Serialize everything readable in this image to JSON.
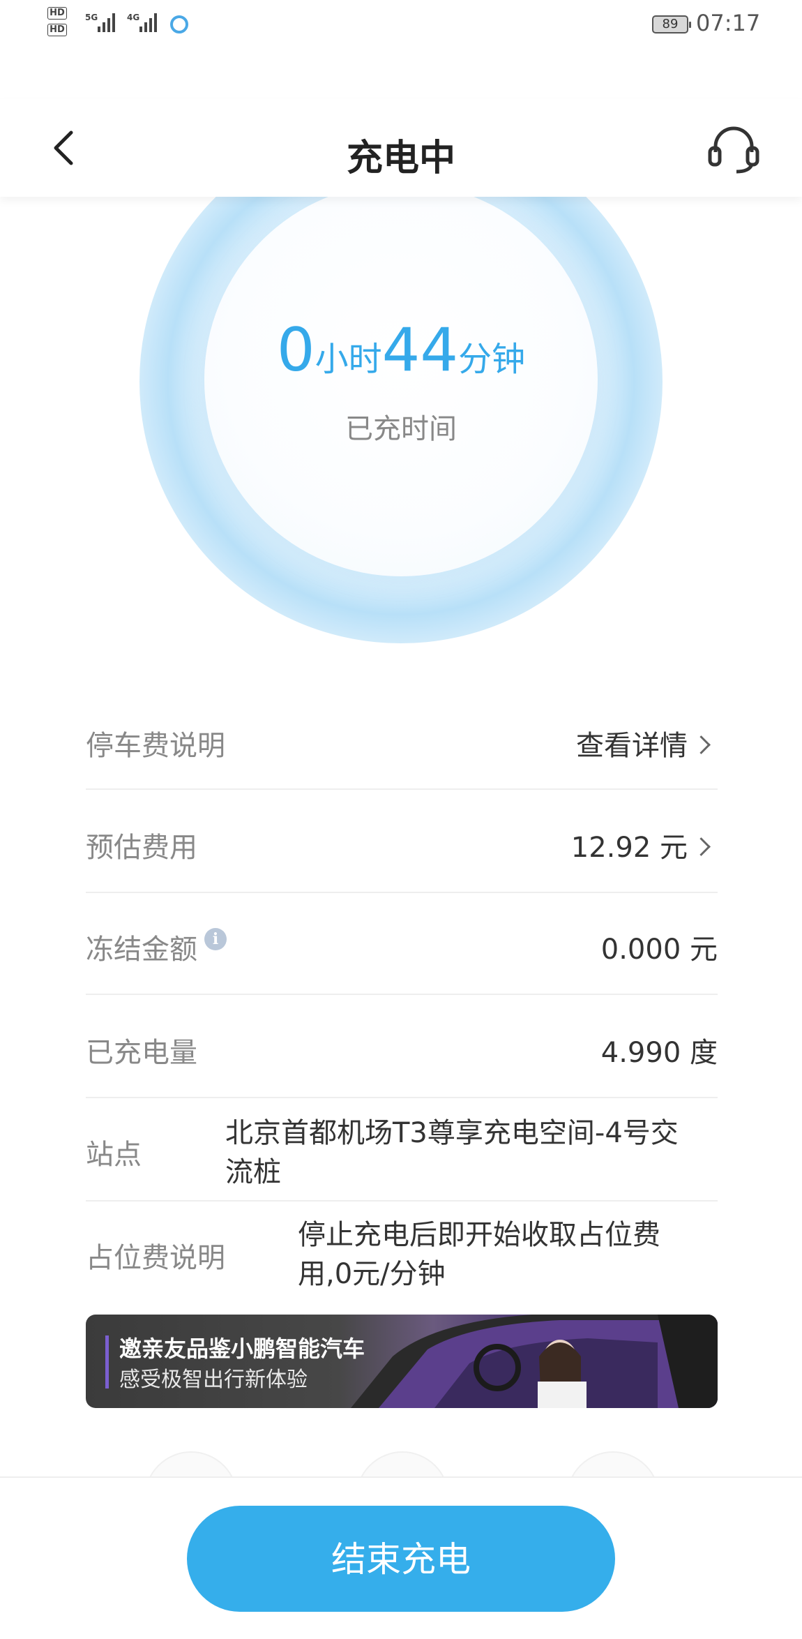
{
  "status_bar": {
    "hd1": "HD",
    "hd2": "HD",
    "net1": "5G",
    "net2": "4G",
    "battery": "89",
    "time": "07:17"
  },
  "header": {
    "title": "充电中",
    "back_icon": "chevron-left-icon",
    "support_icon": "headset-icon"
  },
  "timer": {
    "hours": "0",
    "hours_unit": "小时",
    "minutes": "44",
    "minutes_unit": "分钟",
    "label": "已充时间"
  },
  "rows": {
    "parking": {
      "label": "停车费说明",
      "value": "查看详情"
    },
    "estimate": {
      "label": "预估费用",
      "value": "12.92 元"
    },
    "frozen": {
      "label": "冻结金额",
      "value": "0.000 元",
      "icon": "info-icon"
    },
    "energy": {
      "label": "已充电量",
      "value": "4.990 度"
    },
    "station": {
      "label": "站点",
      "value_line1": "北京首都机场T3尊享充电空间-4号交",
      "value_line2": "流桩"
    },
    "occupancy": {
      "label": "占位费说明",
      "value_line1": "停止充电后即开始收取占位费",
      "value_line2": "用,0元/分钟"
    }
  },
  "banner": {
    "title": "邀亲友品鉴小鹏智能汽车",
    "subtitle": "感受极智出行新体验"
  },
  "bottom": {
    "end_button": "结束充电"
  },
  "colors": {
    "accent": "#35aeeb",
    "timer": "#35a9ea"
  }
}
